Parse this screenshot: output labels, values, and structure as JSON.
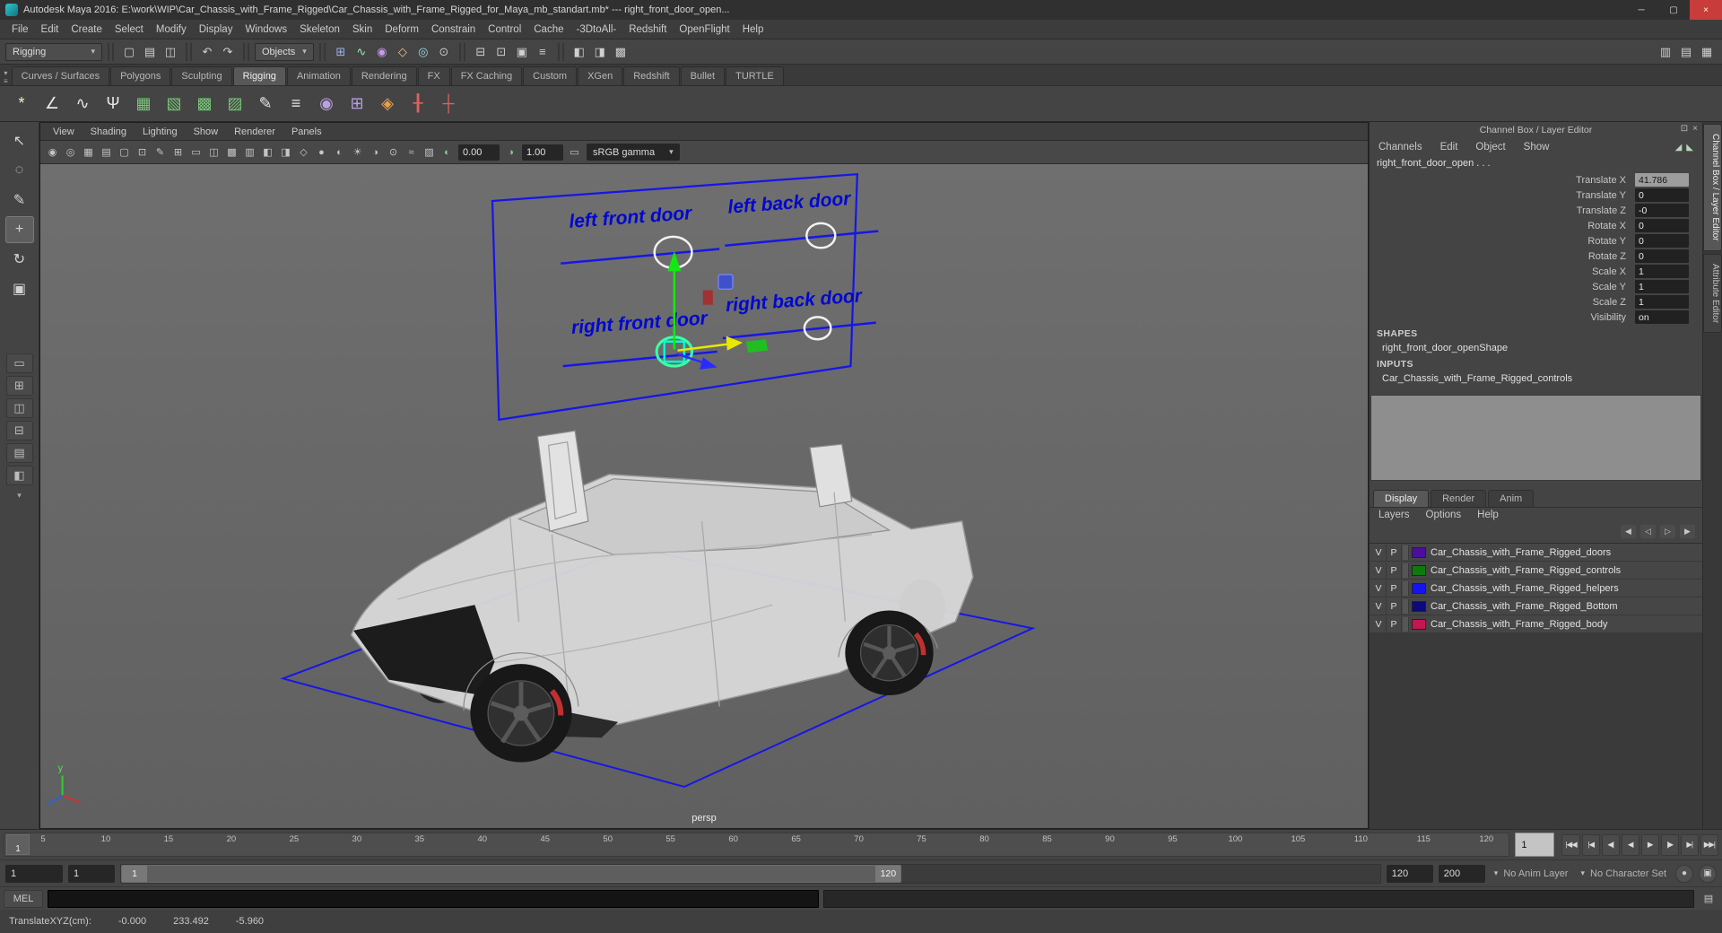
{
  "window": {
    "title": "Autodesk Maya 2016: E:\\work\\WIP\\Car_Chassis_with_Frame_Rigged\\Car_Chassis_with_Frame_Rigged_for_Maya_mb_standart.mb*  ---  right_front_door_open...",
    "controls": {
      "minimize": "─",
      "maximize": "▢",
      "close": "×"
    }
  },
  "menubar": {
    "items": [
      "File",
      "Edit",
      "Create",
      "Select",
      "Modify",
      "Display",
      "Windows",
      "Skeleton",
      "Skin",
      "Deform",
      "Constrain",
      "Control",
      "Cache",
      "-3DtoAll-",
      "Redshift",
      "OpenFlight",
      "Help"
    ]
  },
  "statusline": {
    "menu_set": "Rigging",
    "objects_label": "Objects",
    "file_icons": [
      {
        "name": "new-scene-icon",
        "glyph": "▢"
      },
      {
        "name": "open-scene-icon",
        "glyph": "▤"
      },
      {
        "name": "save-scene-icon",
        "glyph": "◫"
      }
    ],
    "undo_icons": [
      {
        "name": "undo-icon",
        "glyph": "↶"
      },
      {
        "name": "redo-icon",
        "glyph": "↷"
      }
    ],
    "snap_icons": [
      {
        "name": "snap-to-grid-icon",
        "glyph": "⊞",
        "color": "#9ab4e8"
      },
      {
        "name": "snap-to-curve-icon",
        "glyph": "∿",
        "color": "#9ae8b4"
      },
      {
        "name": "snap-to-point-icon",
        "glyph": "◉",
        "color": "#c89ae8"
      },
      {
        "name": "snap-to-plane-icon",
        "glyph": "◇",
        "color": "#e8c89a"
      },
      {
        "name": "make-live-icon",
        "glyph": "◎",
        "color": "#9ad8e8"
      },
      {
        "name": "snap-together-icon",
        "glyph": "⊙",
        "color": "#c8c8c8"
      }
    ],
    "history_icons": [
      {
        "name": "input-connections-icon",
        "glyph": "⊟"
      },
      {
        "name": "output-connections-icon",
        "glyph": "⊡"
      },
      {
        "name": "construction-history-icon",
        "glyph": "▣"
      },
      {
        "name": "list-input-operations-icon",
        "glyph": "≡"
      }
    ],
    "render_icons": [
      {
        "name": "render-current-frame-icon",
        "glyph": "◧"
      },
      {
        "name": "ipr-render-icon",
        "glyph": "◨"
      },
      {
        "name": "render-settings-icon",
        "glyph": "▩"
      }
    ],
    "sidebar_icons": [
      {
        "name": "attribute-editor-toggle-icon",
        "glyph": "▥"
      },
      {
        "name": "tool-settings-toggle-icon",
        "glyph": "▤"
      },
      {
        "name": "channel-box-toggle-icon",
        "glyph": "▦"
      }
    ]
  },
  "shelf": {
    "mini_arrow": "▾",
    "mini_menu": "≡",
    "tabs": [
      {
        "label": "Curves / Surfaces"
      },
      {
        "label": "Polygons"
      },
      {
        "label": "Sculpting"
      },
      {
        "label": "Rigging",
        "active": true
      },
      {
        "label": "Animation"
      },
      {
        "label": "Rendering"
      },
      {
        "label": "FX"
      },
      {
        "label": "FX Caching"
      },
      {
        "label": "Custom"
      },
      {
        "label": "XGen"
      },
      {
        "label": "Redshift"
      },
      {
        "label": "Bullet"
      },
      {
        "label": "TURTLE"
      }
    ],
    "items": [
      {
        "name": "create-joint-icon",
        "glyph": "*",
        "color": "#f0f0c8"
      },
      {
        "name": "ik-handle-icon",
        "glyph": "∠",
        "color": "#e6e6e6"
      },
      {
        "name": "ik-spline-handle-icon",
        "glyph": "∿",
        "color": "#e6e6e6"
      },
      {
        "name": "skeleton-hik-icon",
        "glyph": "Ψ",
        "color": "#e6e6e6"
      },
      {
        "name": "bind-skin-icon",
        "glyph": "▦",
        "color": "#79c879"
      },
      {
        "name": "interactive-bind-icon",
        "glyph": "▧",
        "color": "#79c879"
      },
      {
        "name": "geodesic-voxel-bind-icon",
        "glyph": "▩",
        "color": "#79c879"
      },
      {
        "name": "detach-skin-icon",
        "glyph": "▨",
        "color": "#79c879"
      },
      {
        "name": "paint-skin-weights-icon",
        "glyph": "✎",
        "color": "#e6e6e6"
      },
      {
        "name": "blend-shape-icon",
        "glyph": "≡",
        "color": "#e6e6e6"
      },
      {
        "name": "cluster-icon",
        "glyph": "◉",
        "color": "#b9a0e0"
      },
      {
        "name": "lattice-icon",
        "glyph": "⊞",
        "color": "#b9a0e0"
      },
      {
        "name": "wrap-deformer-icon",
        "glyph": "◈",
        "color": "#e8a050"
      },
      {
        "name": "muscle-icon",
        "glyph": "╂",
        "color": "#e06060"
      },
      {
        "name": "muscle-spline-icon",
        "glyph": "┼",
        "color": "#e06060"
      }
    ]
  },
  "toolbox": {
    "tools": [
      {
        "name": "select-tool",
        "glyph": "↖"
      },
      {
        "name": "lasso-select-tool",
        "glyph": "◌"
      },
      {
        "name": "paint-select-tool",
        "glyph": "✎"
      },
      {
        "name": "move-tool",
        "glyph": "+",
        "active": true
      },
      {
        "name": "rotate-tool",
        "glyph": "↻"
      },
      {
        "name": "scale-tool",
        "glyph": "▣"
      }
    ],
    "layouts": [
      {
        "name": "single-pane-layout-button",
        "glyph": "▭"
      },
      {
        "name": "four-pane-layout-button",
        "glyph": "⊞"
      },
      {
        "name": "persp-outliner-layout-button",
        "glyph": "◫"
      },
      {
        "name": "persp-graph-layout-button",
        "glyph": "⊟"
      },
      {
        "name": "hypershade-persp-layout-button",
        "glyph": "▤"
      },
      {
        "name": "persp-uv-layout-button",
        "glyph": "◧"
      }
    ],
    "layout_more": "▾"
  },
  "viewport": {
    "menus": [
      "View",
      "Shading",
      "Lighting",
      "Show",
      "Renderer",
      "Panels"
    ],
    "toolbar_icons": [
      {
        "name": "select-camera-icon",
        "glyph": "◉"
      },
      {
        "name": "lock-camera-icon",
        "glyph": "◎"
      },
      {
        "name": "camera-attributes-icon",
        "glyph": "▦"
      },
      {
        "name": "bookmarks-icon",
        "glyph": "▤"
      },
      {
        "name": "image-plane-icon",
        "glyph": "▢"
      },
      {
        "name": "two-d-pan-zoom-icon",
        "glyph": "⊡"
      },
      {
        "name": "grease-pencil-icon",
        "glyph": "✎"
      },
      {
        "name": "grid-toggle-icon",
        "glyph": "⊞"
      },
      {
        "name": "film-gate-icon",
        "glyph": "▭"
      },
      {
        "name": "resolution-gate-icon",
        "glyph": "◫"
      },
      {
        "name": "gate-mask-icon",
        "glyph": "▩"
      },
      {
        "name": "field-chart-icon",
        "glyph": "▥"
      },
      {
        "name": "safe-action-icon",
        "glyph": "◧"
      },
      {
        "name": "safe-title-icon",
        "glyph": "◨"
      },
      {
        "name": "wireframe-mode-icon",
        "glyph": "◇"
      },
      {
        "name": "shaded-mode-icon",
        "glyph": "●"
      },
      {
        "name": "textured-mode-icon",
        "glyph": "◐"
      },
      {
        "name": "use-all-lights-icon",
        "glyph": "☀"
      },
      {
        "name": "shadows-icon",
        "glyph": "◑"
      },
      {
        "name": "occlusion-icon",
        "glyph": "⊙"
      },
      {
        "name": "motion-blur-icon",
        "glyph": "≈"
      },
      {
        "name": "multisample-icon",
        "glyph": "▨"
      }
    ],
    "exposure_value": "0.00",
    "gamma_value": "1.00",
    "view_transform": "sRGB gamma",
    "dropdown_caret": "▾",
    "camera_label": "persp",
    "overlay": {
      "door_labels": [
        "left front door",
        "left back door",
        "right front door",
        "right back door"
      ],
      "axis_label_y": "y"
    }
  },
  "channel_box": {
    "title": "Channel Box / Layer Editor",
    "title_icons": [
      {
        "name": "panel-dock-icon",
        "glyph": "⊡"
      },
      {
        "name": "panel-close-icon",
        "glyph": "×"
      }
    ],
    "menus": [
      "Channels",
      "Edit",
      "Object",
      "Show"
    ],
    "mini_icons": [
      {
        "name": "speed-slider-icon",
        "glyph": "◢"
      },
      {
        "name": "hyperbolic-slider-icon",
        "glyph": "◣"
      }
    ],
    "object_name": "right_front_door_open . . .",
    "attributes": [
      {
        "label": "Translate X",
        "value": "41.786",
        "active": true
      },
      {
        "label": "Translate Y",
        "value": "0"
      },
      {
        "label": "Translate Z",
        "value": "-0"
      },
      {
        "label": "Rotate X",
        "value": "0"
      },
      {
        "label": "Rotate Y",
        "value": "0"
      },
      {
        "label": "Rotate Z",
        "value": "0"
      },
      {
        "label": "Scale X",
        "value": "1"
      },
      {
        "label": "Scale Y",
        "value": "1"
      },
      {
        "label": "Scale Z",
        "value": "1"
      },
      {
        "label": "Visibility",
        "value": "on"
      }
    ],
    "shapes_header": "SHAPES",
    "shape_name": "right_front_door_openShape",
    "inputs_header": "INPUTS",
    "input_name": "Car_Chassis_with_Frame_Rigged_controls"
  },
  "layer_editor": {
    "tabs": [
      {
        "label": "Display",
        "active": true
      },
      {
        "label": "Render"
      },
      {
        "label": "Anim"
      }
    ],
    "menus": [
      "Layers",
      "Options",
      "Help"
    ],
    "icons": [
      {
        "name": "move-layer-up-button",
        "glyph": "◀"
      },
      {
        "name": "move-layer-down-button",
        "glyph": "◁"
      },
      {
        "name": "add-empty-layer-button",
        "glyph": "▷"
      },
      {
        "name": "add-layer-from-selected-button",
        "glyph": "▶"
      }
    ],
    "layers": [
      {
        "v": "V",
        "p": "P",
        "color": "#4b0e9e",
        "name": "Car_Chassis_with_Frame_Rigged_doors"
      },
      {
        "v": "V",
        "p": "P",
        "color": "#0e7a0e",
        "name": "Car_Chassis_with_Frame_Rigged_controls"
      },
      {
        "v": "V",
        "p": "P",
        "color": "#1414f0",
        "name": "Car_Chassis_with_Frame_Rigged_helpers"
      },
      {
        "v": "V",
        "p": "P",
        "color": "#0a0a78",
        "name": "Car_Chassis_with_Frame_Rigged_Bottom"
      },
      {
        "v": "V",
        "p": "P",
        "color": "#c41650",
        "name": "Car_Chassis_with_Frame_Rigged_body"
      }
    ]
  },
  "side_tabs": [
    {
      "label": "Channel Box / Layer Editor",
      "active": true
    },
    {
      "label": "Attribute Editor"
    }
  ],
  "timeline": {
    "ticks": [
      "5",
      "10",
      "15",
      "20",
      "25",
      "30",
      "35",
      "40",
      "45",
      "50",
      "55",
      "60",
      "65",
      "70",
      "75",
      "80",
      "85",
      "90",
      "95",
      "100",
      "105",
      "110",
      "115",
      "120"
    ],
    "current_marker": "1",
    "current_time_field": "1",
    "playback_buttons": [
      {
        "name": "go-to-start-button",
        "glyph": "|◀◀"
      },
      {
        "name": "step-back-key-button",
        "glyph": "|◀"
      },
      {
        "name": "step-back-frame-button",
        "glyph": "◀|"
      },
      {
        "name": "play-backwards-button",
        "glyph": "◀"
      },
      {
        "name": "play-forward-button",
        "glyph": "▶"
      },
      {
        "name": "step-forward-frame-button",
        "glyph": "|▶"
      },
      {
        "name": "step-forward-key-button",
        "glyph": "▶|"
      },
      {
        "name": "go-to-end-button",
        "glyph": "▶▶|"
      }
    ]
  },
  "range_slider": {
    "playback_start": "1",
    "anim_start": "1",
    "range_start_handle": "1",
    "range_end_handle": "120",
    "playback_end": "120",
    "anim_end": "200",
    "anim_layer_label": "No Anim Layer",
    "character_set_label": "No Character Set",
    "caret": "▾",
    "auto_key_glyph": "●",
    "prefs_glyph": "▣"
  },
  "command_line": {
    "label": "MEL"
  },
  "helpline": {
    "label": "TranslateXYZ(cm):",
    "values": [
      "-0.000",
      "233.492",
      "-5.960"
    ]
  }
}
